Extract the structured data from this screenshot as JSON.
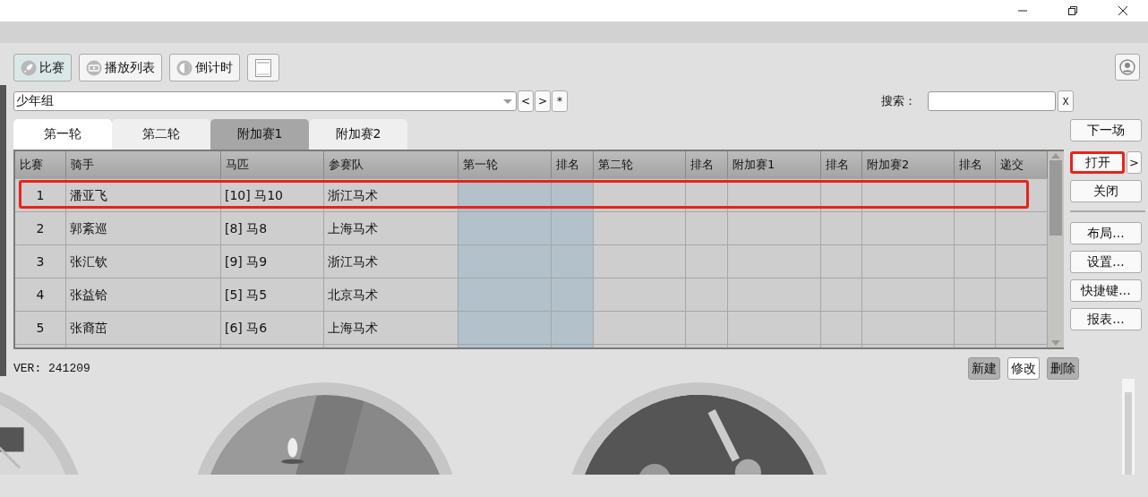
{
  "toolbar": [
    {
      "kind": "rocket",
      "label": "比赛",
      "selected": true
    },
    {
      "kind": "playlist",
      "label": "播放列表",
      "selected": false
    },
    {
      "kind": "clock",
      "label": "倒计时",
      "selected": false
    },
    {
      "kind": "page",
      "selected": false
    }
  ],
  "group_select": {
    "value": "少年组"
  },
  "nav_buttons": [
    "<",
    ">",
    "*"
  ],
  "search": {
    "label": "搜索：",
    "clear": "X"
  },
  "tabs": [
    {
      "label": "第一轮",
      "selected": true,
      "hovered": false
    },
    {
      "label": "第二轮",
      "selected": false,
      "hovered": false
    },
    {
      "label": "附加赛1",
      "selected": false,
      "hovered": true
    },
    {
      "label": "附加赛2",
      "selected": false,
      "hovered": false
    }
  ],
  "table": {
    "columns": [
      {
        "label": "比赛",
        "highlighted": false
      },
      {
        "label": "骑手",
        "highlighted": false
      },
      {
        "label": "马匹",
        "highlighted": false
      },
      {
        "label": "参赛队",
        "highlighted": false
      },
      {
        "label": "第一轮",
        "highlighted": true
      },
      {
        "label": "排名",
        "highlighted": true
      },
      {
        "label": "第二轮",
        "highlighted": false
      },
      {
        "label": "排名",
        "highlighted": false
      },
      {
        "label": "附加赛1",
        "highlighted": false
      },
      {
        "label": "排名",
        "highlighted": false
      },
      {
        "label": "附加赛2",
        "highlighted": false
      },
      {
        "label": "排名",
        "highlighted": false
      },
      {
        "label": "递交",
        "highlighted": false
      }
    ],
    "rows": [
      {
        "number": "1",
        "rider": "潘亚飞",
        "horse": "[10] 马10",
        "team": "浙江马术",
        "annotated": true
      },
      {
        "number": "2",
        "rider": "郭紊巡",
        "horse": "[8] 马8",
        "team": "上海马术",
        "annotated": false
      },
      {
        "number": "3",
        "rider": "张汇钦",
        "horse": "[9] 马9",
        "team": "浙江马术",
        "annotated": false
      },
      {
        "number": "4",
        "rider": "张益铪",
        "horse": "[5] 马5",
        "team": "北京马术",
        "annotated": false
      },
      {
        "number": "5",
        "rider": "张裔茁",
        "horse": "[6] 马6",
        "team": "上海马术",
        "annotated": false
      }
    ]
  },
  "side_buttons": [
    [
      {
        "label": "下一场",
        "annotated": false
      },
      {
        "label": "打开",
        "annotated": true,
        "menu": ">"
      },
      {
        "label": "关闭",
        "annotated": false
      }
    ],
    [
      {
        "label": "布局..."
      },
      {
        "label": "设置..."
      },
      {
        "label": "快捷键..."
      },
      {
        "label": "报表..."
      }
    ]
  ],
  "version": "VER: 241209",
  "actions": [
    {
      "label": "新建",
      "shaded": true
    },
    {
      "label": "修改",
      "shaded": false
    },
    {
      "label": "删除",
      "shaded": true
    }
  ]
}
